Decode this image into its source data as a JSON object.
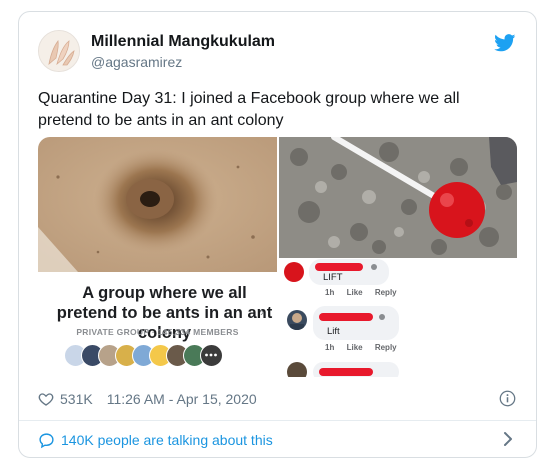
{
  "tweet": {
    "display_name": "Millennial Mangkukulam",
    "handle": "@agasramirez",
    "text": "Quarantine Day 31: I joined a Facebook group where we all pretend to be ants in an ant colony",
    "likes": "531K",
    "timestamp": "11:26 AM - Apr 15, 2020",
    "talking": "140K people are talking about this",
    "brand_color": "#1da1f2",
    "link_color": "#1b95e0"
  },
  "media": {
    "group_title": "A group where we all pretend to be ants in an ant colony",
    "group_chevron": "›",
    "group_meta": "PRIVATE GROUP · 145,334 MEMBERS",
    "comments": [
      {
        "text": "LIFT",
        "like": "Like",
        "reply": "Reply",
        "time": "1h"
      },
      {
        "text": "Lift",
        "like": "Like",
        "reply": "Reply",
        "time": "1h"
      }
    ]
  },
  "icons": {
    "bird": "twitter-bird-icon",
    "heart": "heart-icon",
    "info": "info-icon",
    "bubble": "speech-bubble-icon",
    "chevron": "chevron-right-icon"
  }
}
